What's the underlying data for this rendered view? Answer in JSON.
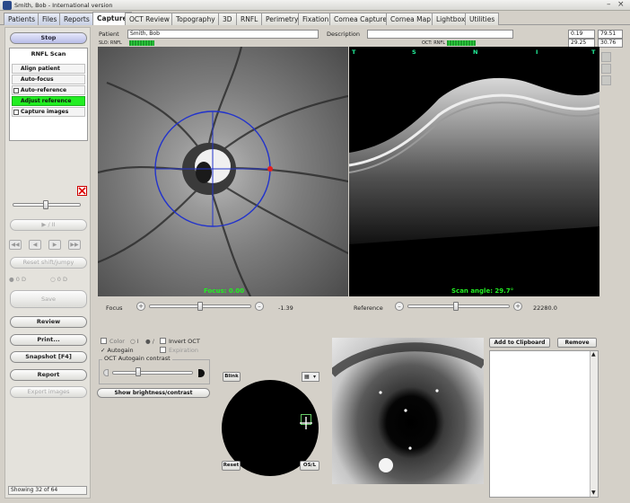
{
  "window": {
    "title": "Smith, Bob - International version",
    "close_glyph": "×",
    "minimize_glyph": "–"
  },
  "tabs": [
    {
      "label": "Patients"
    },
    {
      "label": "Files"
    },
    {
      "label": "Reports"
    },
    {
      "label": "Capture"
    },
    {
      "label": "OCT Review"
    },
    {
      "label": "Topography"
    },
    {
      "label": "3D"
    },
    {
      "label": "RNFL"
    },
    {
      "label": "Perimetry"
    },
    {
      "label": "Fixation"
    },
    {
      "label": "Cornea Capture"
    },
    {
      "label": "Cornea Map"
    },
    {
      "label": "Lightbox"
    },
    {
      "label": "Utilities"
    }
  ],
  "sidebar": {
    "stop_label": "Stop",
    "rnfl_header": "RNFL Scan",
    "steps": [
      "Align patient",
      "Auto-focus",
      "Auto-reference",
      "Adjust reference",
      "Capture images"
    ],
    "play_pause": "▶ / II",
    "reset_label": "Reset shift/jumpy",
    "radio1": "0 D",
    "radio2": "0 D",
    "save_label": "Save",
    "review_label": "Review",
    "print_label": "Print...",
    "snapshot_label": "Snapshot [F4]",
    "report_label": "Report",
    "export_label": "Export images",
    "status": "Showing 32 of 64"
  },
  "header": {
    "patient_label": "Patient",
    "patient_value": "Smith, Bob",
    "description_label": "Description",
    "sub_label": "SLO: RNFL",
    "oct_label": "OCT: RNFL",
    "val_a": "0.19",
    "val_b": "79.51",
    "val_c": "29.25",
    "val_d": "30.76"
  },
  "slo": {
    "focus_overlay": "Focus: 0.00",
    "focus_label": "Focus",
    "focus_value": "-1.39"
  },
  "oct": {
    "scan_angle": "Scan angle: 29.7°",
    "reference_label": "Reference",
    "reference_value": "22280.0",
    "markers": [
      "T",
      "S",
      "N",
      "I",
      "T"
    ]
  },
  "controls": {
    "color_label": "Color",
    "opt1": "I",
    "opt2": "/",
    "invert_label": "Invert OCT",
    "autogain_label": "Autogain",
    "extra_label": "Expiration",
    "contrast_group": "OCT Autogain contrast",
    "show_bc_label": "Show brightness/contrast"
  },
  "fixation": {
    "blink_label": "Blink",
    "reset_label": "Reset",
    "os_label": "OS/L"
  },
  "right": {
    "clipboard_label": "Add to Clipboard",
    "remove_label": "Remove"
  }
}
